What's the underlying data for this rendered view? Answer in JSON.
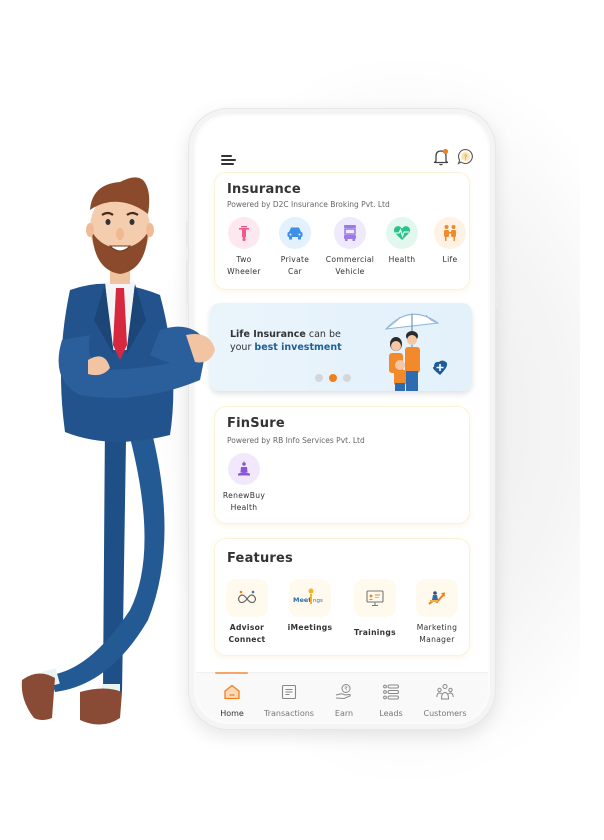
{
  "header": {
    "menu_icon": "hamburger-menu-icon",
    "notification_icon": "bell-icon",
    "help_icon": "help-chat-icon",
    "accent_color": "#f07f1e"
  },
  "insurance": {
    "title": "Insurance",
    "subtitle": "Powered by D2C Insurance Broking Pvt. Ltd",
    "items": [
      {
        "line1": "Two",
        "line2": "Wheeler",
        "icon": "scooter-icon",
        "color": "#f05a8a",
        "bg": "#fde8ef"
      },
      {
        "line1": "Private",
        "line2": "Car",
        "icon": "car-icon",
        "color": "#3d8fe8",
        "bg": "#e2f1fc"
      },
      {
        "line1": "Commercial",
        "line2": "Vehicle",
        "icon": "truck-icon",
        "color": "#9b79e6",
        "bg": "#efe9fc"
      },
      {
        "line1": "Health",
        "line2": "",
        "icon": "heart-pulse-icon",
        "color": "#29c38a",
        "bg": "#e2f8ef"
      },
      {
        "line1": "Life",
        "line2": "",
        "icon": "family-icon",
        "color": "#f28a2c",
        "bg": "#fdf2e4"
      }
    ]
  },
  "banner": {
    "text_bold": "Life Insurance",
    "text_plain_1": " can be your ",
    "text_highlight": "best investment",
    "slides": 3,
    "active_slide": 2
  },
  "finsure": {
    "title": "FinSure",
    "subtitle": "Powered by RB Info Services  Pvt. Ltd",
    "items": [
      {
        "line1": "RenewBuy",
        "line2": "Health",
        "icon": "meditation-icon",
        "color": "#8a55d6",
        "bg": "#f1e9fb"
      }
    ]
  },
  "features": {
    "title": "Features",
    "items": [
      {
        "line1": "Advisor",
        "line2": "Connect",
        "icon": "advisor-connect-icon"
      },
      {
        "line1": "iMeetings",
        "line2": "",
        "icon": "imeetings-logo-icon"
      },
      {
        "line1": "Trainings",
        "line2": "",
        "icon": "presentation-board-icon"
      },
      {
        "line1": "Marketing",
        "line2": "Manager",
        "icon": "growth-chart-icon"
      }
    ]
  },
  "bottom_nav": {
    "active": "Home",
    "items": [
      {
        "label": "Home",
        "icon": "home-icon"
      },
      {
        "label": "Transactions",
        "icon": "document-list-icon"
      },
      {
        "label": "Earn",
        "icon": "rupee-hand-icon"
      },
      {
        "label": "Leads",
        "icon": "list-icon"
      },
      {
        "label": "Customers",
        "icon": "people-group-icon"
      }
    ]
  },
  "illustration": {
    "character": "businessman-mascot"
  }
}
